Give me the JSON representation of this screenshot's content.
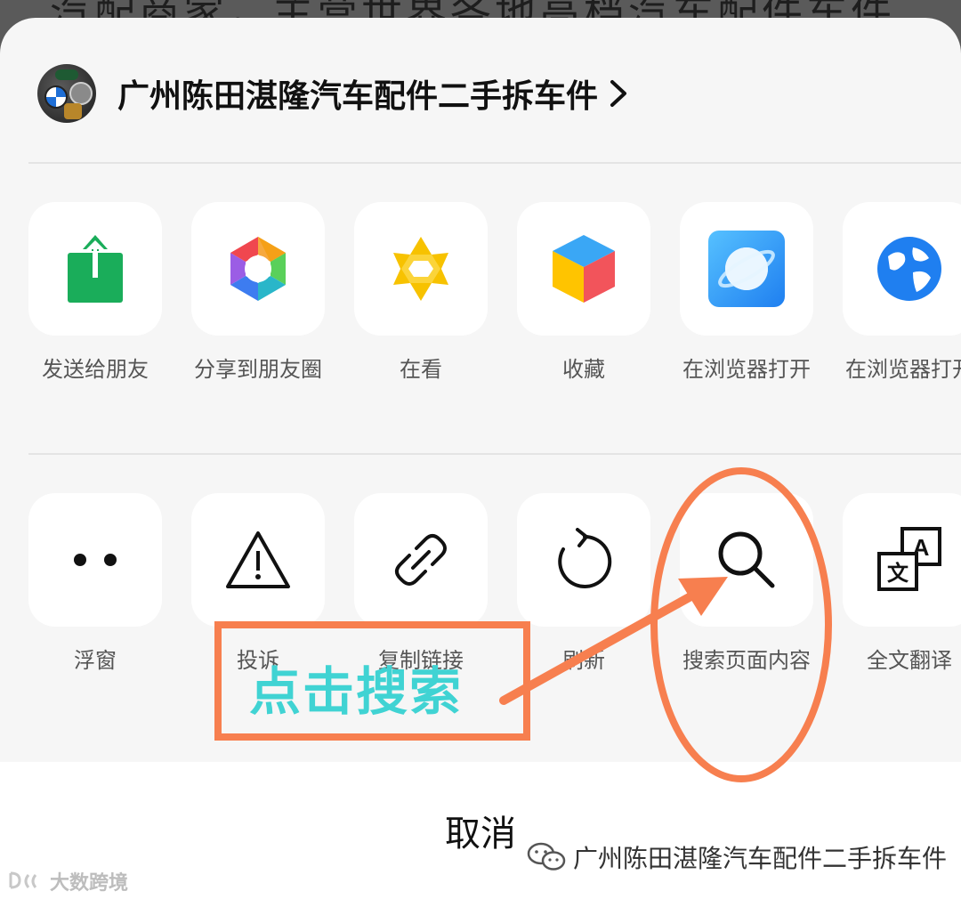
{
  "background": {
    "text": "汽配商家，主营世界各地高档汽车配件车件"
  },
  "header": {
    "title": "广州陈田湛隆汽车配件二手拆车件"
  },
  "row1": [
    {
      "icon": "share-up-icon",
      "label": "发送给朋友"
    },
    {
      "icon": "moments-aperture-icon",
      "label": "分享到朋友圈"
    },
    {
      "icon": "wow-star-icon",
      "label": "在看"
    },
    {
      "icon": "favorite-cube-icon",
      "label": "收藏"
    },
    {
      "icon": "browser-planet-icon",
      "label": "在浏览器打开"
    },
    {
      "icon": "globe-icon",
      "label": "在浏览器打开"
    }
  ],
  "row2": [
    {
      "icon": "floating-window-icon",
      "label": "浮窗"
    },
    {
      "icon": "warning-icon",
      "label": "投诉"
    },
    {
      "icon": "link-icon",
      "label": "复制链接"
    },
    {
      "icon": "refresh-icon",
      "label": "刷新"
    },
    {
      "icon": "search-icon",
      "label": "搜索页面内容"
    },
    {
      "icon": "translate-icon",
      "label": "全文翻译"
    }
  ],
  "cancel": {
    "label": "取消"
  },
  "annotation": {
    "text": "点击搜索",
    "color": "#f77f4f",
    "text_color": "#40d3d3"
  },
  "watermark": {
    "right": "广州陈田湛隆汽车配件二手拆车件",
    "left": "大数跨境"
  },
  "colors": {
    "sheet_bg": "#f6f6f6",
    "tile_bg": "#ffffff",
    "share_green": "#1aad5a",
    "browser_blue": "#2d8cf0",
    "globe_blue": "#1f7ff0"
  }
}
